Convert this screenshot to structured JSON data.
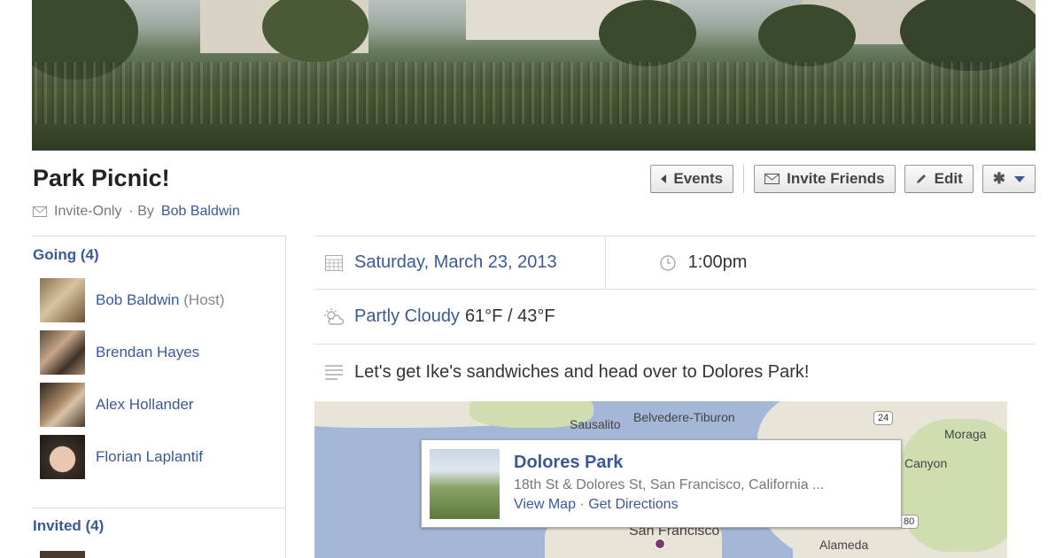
{
  "event": {
    "title": "Park Picnic!",
    "privacy": "Invite-Only",
    "by_prefix": "· By",
    "host_name": "Bob Baldwin"
  },
  "actions": {
    "events_label": "Events",
    "invite_label": "Invite Friends",
    "edit_label": "Edit"
  },
  "going": {
    "heading": "Going (4)",
    "people": [
      {
        "name": "Bob Baldwin",
        "note": "(Host)"
      },
      {
        "name": "Brendan Hayes",
        "note": ""
      },
      {
        "name": "Alex Hollander",
        "note": ""
      },
      {
        "name": "Florian Laplantif",
        "note": ""
      }
    ]
  },
  "invited": {
    "heading": "Invited (4)"
  },
  "details": {
    "date": "Saturday, March 23, 2013",
    "time": "1:00pm",
    "weather_link": "Partly Cloudy",
    "temps": "61°F / 43°F",
    "description": "Let's get Ike's sandwiches and head over to Dolores Park!"
  },
  "map": {
    "labels": [
      "Sausalito",
      "Belvedere-Tiburon",
      "Moraga",
      "Canyon",
      "San Francisco",
      "Alameda"
    ],
    "shields": [
      "24",
      "80"
    ],
    "place_name": "Dolores Park",
    "place_address": "18th St & Dolores St, San Francisco, California ...",
    "view_map": "View Map",
    "dot": "·",
    "get_directions": "Get Directions"
  },
  "icons": {
    "invite": "envelope-icon",
    "back": "caret-left-icon",
    "edit": "pencil-icon",
    "settings": "gear-icon",
    "dropdown": "caret-down-icon",
    "date": "calendar-icon",
    "time": "clock-icon",
    "weather": "weather-icon",
    "description": "text-lines-icon"
  },
  "colors": {
    "link": "#3b5998"
  }
}
